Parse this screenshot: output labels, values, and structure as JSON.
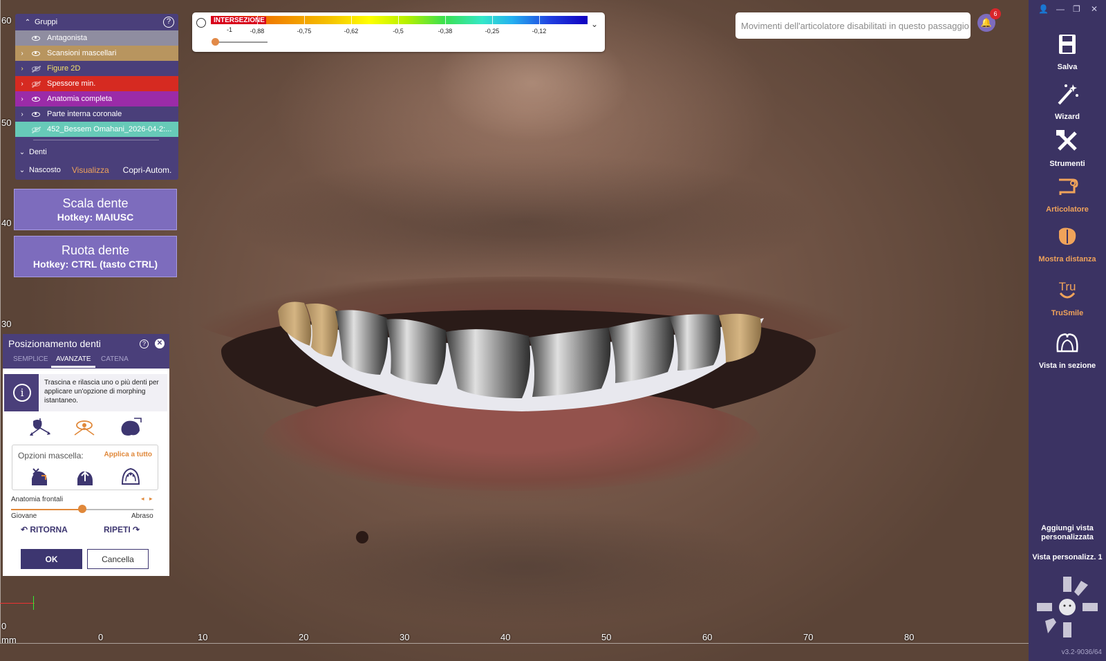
{
  "groups": {
    "header": "Gruppi",
    "help": "?",
    "rows": [
      {
        "label": "Antagonista",
        "color": "#8f8da0",
        "text_color": "#ffffff",
        "chevron": "",
        "eye": "on"
      },
      {
        "label": "Scansioni mascellari",
        "color": "#b8955f",
        "text_color": "#ffffff",
        "chevron": "›",
        "eye": "on"
      },
      {
        "label": "Figure 2D",
        "color": "#4a3f7a",
        "text_color": "#f5e36a",
        "chevron": "›",
        "eye": "off"
      },
      {
        "label": "Spessore min.",
        "color": "#d62a21",
        "text_color": "#ffffff",
        "chevron": "›",
        "eye": "off"
      },
      {
        "label": "Anatomia completa",
        "color": "#9b2ba8",
        "text_color": "#ffffff",
        "chevron": "›",
        "eye": "on"
      },
      {
        "label": "Parte interna coronale",
        "color": "#4a3f7a",
        "text_color": "#ffffff",
        "chevron": "›",
        "eye": "on"
      },
      {
        "label": "452_Bessem Omahani_2026-04-2:...",
        "color": "#67cab8",
        "text_color": "#ffffff",
        "chevron": "",
        "eye": "off"
      }
    ],
    "teeth_label": "Denti",
    "hidden_label": "Nascosto",
    "show_link": "Visualizza",
    "auto_cover": "Copri-Autom."
  },
  "buttons": {
    "scale": {
      "title": "Scala dente",
      "hotkey": "Hotkey: MAIUSC"
    },
    "rotate": {
      "title": "Ruota dente",
      "hotkey": "Hotkey: CTRL (tasto CTRL)"
    }
  },
  "color_scale": {
    "title": "INTERSEZIONE",
    "labels": [
      "-1",
      "-0,88",
      "-0,75",
      "-0,62",
      "-0,5",
      "-0,38",
      "-0,25",
      "-0,12"
    ],
    "chevron": "⌄"
  },
  "notice": {
    "text": "Movimenti dell'articolatore disabilitati in questo passaggio",
    "badge": "6"
  },
  "dialog": {
    "title": "Posizionamento denti",
    "tabs": [
      "SEMPLICE",
      "AVANZATE",
      "CATENA"
    ],
    "active_tab": "AVANZATE",
    "info": "Trascina e rilascia uno o più denti per applicare un'opzione di morphing istantaneo.",
    "jaw_options_label": "Opzioni mascella:",
    "apply_all": "Applica a tutto",
    "anatomy_label": "Anatomia frontali",
    "slider_value": 0.5,
    "slider_min_label": "Giovane",
    "slider_max_label": "Abraso",
    "undo": "RITORNA",
    "redo": "RIPETI",
    "ok": "OK",
    "cancel": "Cancella"
  },
  "sidebar": {
    "items": [
      {
        "label": "Salva",
        "icon": "save-icon",
        "color": "#ffffff"
      },
      {
        "label": "Wizard",
        "icon": "wand-icon",
        "color": "#ffffff"
      },
      {
        "label": "Strumenti",
        "icon": "tools-icon",
        "color": "#ffffff"
      },
      {
        "label": "Articolatore",
        "icon": "articulator-icon",
        "color": "#f0a35a"
      },
      {
        "label": "Mostra distanza",
        "icon": "distance-icon",
        "color": "#f0a35a"
      },
      {
        "label": "TruSmile",
        "icon": "trusmile-icon",
        "color": "#f0a35a"
      },
      {
        "label": "Vista in sezione",
        "icon": "section-view-icon",
        "color": "#ffffff"
      }
    ],
    "add_custom_view": "Aggiungi vista personalizzata",
    "custom_view_1": "Vista personalizz. 1",
    "version": "v3.2-9036/64"
  },
  "rulers": {
    "vertical": [
      "60",
      "50",
      "40",
      "30",
      "0"
    ],
    "horizontal": [
      "0",
      "10",
      "20",
      "30",
      "40",
      "50",
      "60",
      "70",
      "80"
    ],
    "unit": "mm"
  }
}
